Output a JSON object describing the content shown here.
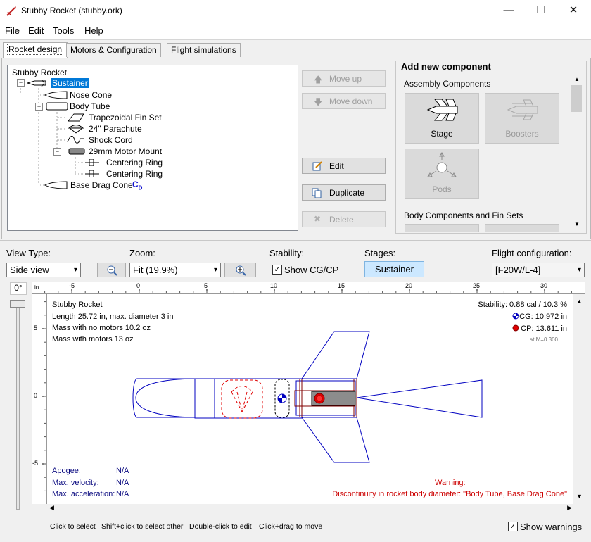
{
  "window": {
    "title": "Stubby Rocket (stubby.ork)",
    "minimize": "—",
    "maximize": "☐",
    "close": "✕"
  },
  "menu": [
    "File",
    "Edit",
    "Tools",
    "Help"
  ],
  "tabs": [
    "Rocket design",
    "Motors & Configuration",
    "Flight simulations"
  ],
  "tree": {
    "root": "Stubby Rocket",
    "sustainer": "Sustainer",
    "nose_cone": "Nose Cone",
    "body_tube": "Body Tube",
    "fin_set": "Trapezoidal Fin Set",
    "parachute": "24\" Parachute",
    "shock_cord": "Shock Cord",
    "motor_mount": "29mm Motor Mount",
    "centering_ring_1": "Centering Ring",
    "centering_ring_2": "Centering Ring",
    "base_drag_cone": "Base Drag Cone",
    "cd_badge": "C",
    "cd_sub": "D"
  },
  "buttons": {
    "move_up": "Move up",
    "move_down": "Move down",
    "edit": "Edit",
    "duplicate": "Duplicate",
    "delete": "Delete"
  },
  "add_component": {
    "title": "Add new component",
    "assembly_header": "Assembly Components",
    "stage": "Stage",
    "boosters": "Boosters",
    "pods": "Pods",
    "body_header": "Body Components and Fin Sets"
  },
  "controls": {
    "view_type_label": "View Type:",
    "view_type_value": "Side view",
    "zoom_label": "Zoom:",
    "zoom_value": "Fit (19.9%)",
    "stability_label": "Stability:",
    "show_cg_cp": "Show CG/CP",
    "stages_label": "Stages:",
    "stage_button": "Sustainer",
    "flight_config_label": "Flight configuration:",
    "flight_config_value": "[F20W/L-4]",
    "rotation": "0°",
    "ruler_unit": "in"
  },
  "ruler_h": [
    "-5",
    "0",
    "5",
    "10",
    "15",
    "20",
    "25",
    "30"
  ],
  "ruler_v": [
    "5",
    "0",
    "-5"
  ],
  "figure": {
    "name": "Stubby Rocket",
    "length": "Length 25.72 in, max. diameter 3 in",
    "mass_no_motor": "Mass with no motors 10.2 oz",
    "mass_motor": "Mass with motors 13 oz",
    "stability": "Stability: 0.88 cal / 10.3 %",
    "cg": "CG: 10.972 in",
    "cp": "CP: 13.611 in",
    "at_mach": "at M=0.300",
    "apogee_label": "Apogee:",
    "apogee_value": "N/A",
    "velocity_label": "Max. velocity:",
    "velocity_value": "N/A",
    "accel_label": "Max. acceleration:",
    "accel_value": "N/A",
    "warning_title": "Warning:",
    "warning_text": "Discontinuity in rocket body diameter:  \"Body Tube, Base Drag Cone\""
  },
  "hints": [
    "Click to select",
    "Shift+click to select other",
    "Double-click to edit",
    "Click+drag to move"
  ],
  "show_warnings": "Show warnings",
  "colors": {
    "selection": "#0078d7",
    "outline": "#0000c0",
    "parachute": "#e00000",
    "stage_button": "#cce8ff",
    "warning": "#cc0000"
  }
}
